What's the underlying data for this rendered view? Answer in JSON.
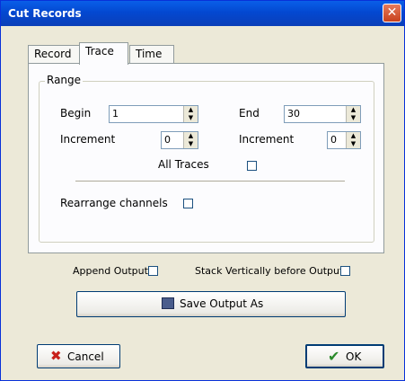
{
  "window": {
    "title": "Cut Records",
    "close_glyph": "✕"
  },
  "tabs": [
    {
      "label": "Record",
      "mnemonic": "R"
    },
    {
      "label": "Trace",
      "mnemonic": "T"
    },
    {
      "label": "Time",
      "mnemonic": "i"
    }
  ],
  "range": {
    "group_label": "Range",
    "begin_label": "Begin",
    "begin_value": "1",
    "end_label": "End",
    "end_value": "30",
    "increment_label": "Increment",
    "increment_left_value": "0",
    "increment_right_value": "0",
    "all_traces_label": "All Traces",
    "all_traces_checked": false,
    "rearrange_label": "Rearrange channels",
    "rearrange_checked": false
  },
  "output": {
    "append_label": "Append Output",
    "append_checked": false,
    "stack_label": "Stack Vertically before Output",
    "stack_checked": false,
    "save_button_label": "Save Output As",
    "save_icon": "save-disk-icon"
  },
  "footer": {
    "cancel_label": "Cancel",
    "cancel_icon": "red-x-icon",
    "ok_label": "OK",
    "ok_icon": "green-check-icon"
  },
  "colors": {
    "titlebar": "#0348D1",
    "dialog_bg": "#ECE9D8",
    "panel_bg": "#FCFCFE",
    "close_button": "#C8411D",
    "cancel_icon": "#C8201A",
    "ok_icon": "#2A8A2A"
  }
}
